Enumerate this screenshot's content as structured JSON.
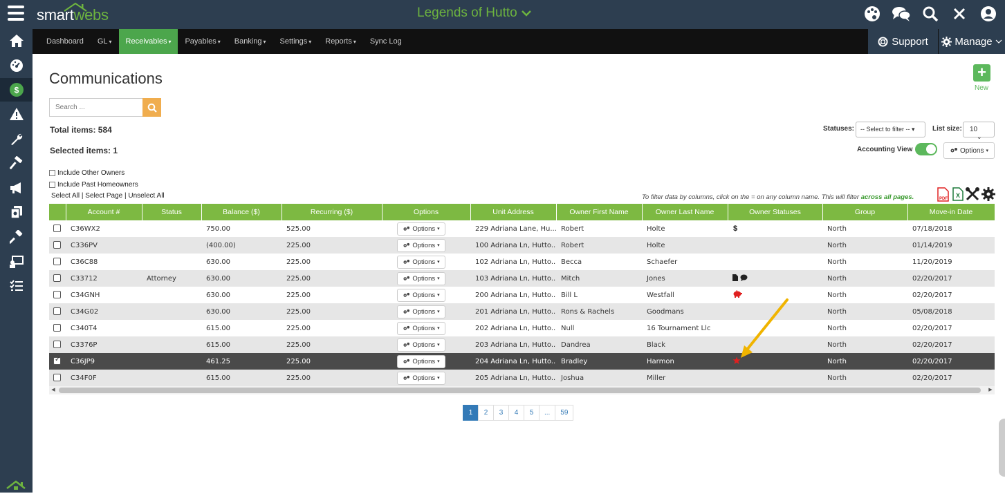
{
  "app": {
    "brand_part1": "smart",
    "brand_part2": "webs",
    "community": "Legends of Hutto"
  },
  "nav": {
    "items": [
      "Dashboard",
      "GL",
      "Receivables",
      "Payables",
      "Banking",
      "Settings",
      "Reports",
      "Sync Log"
    ],
    "dropdown_suffix": "▾",
    "support": "Support",
    "manage": "Manage"
  },
  "page": {
    "title": "Communications",
    "new_label": "New",
    "search_placeholder": "Search ...",
    "total_items": "Total items: 584",
    "selected_items": "Selected items: 1",
    "include_other_owners": "Include Other Owners",
    "include_past_homeowners": "Include Past Homeowners",
    "select_all": "Select All",
    "select_page": "Select Page",
    "unselect_all": "Unselect All",
    "statuses_label": "Statuses:",
    "statuses_select": "-- Select to filter --",
    "list_size_label": "List size:",
    "list_size_value": "10",
    "accounting_view": "Accounting View",
    "options": "Options",
    "filter_note_prefix": "To filter data by columns, click on the = on any column name. This will filter ",
    "filter_note_bold": "across all pages."
  },
  "table": {
    "headers": [
      "",
      "Account #",
      "Status",
      "Balance ($)",
      "Recurring ($)",
      "Options",
      "Unit Address",
      "Owner First Name",
      "Owner Last Name",
      "Owner Statuses",
      "Group",
      "Move-in Date"
    ],
    "rows": [
      {
        "checked": false,
        "account": "C36WX2",
        "status": "",
        "balance": "750.00",
        "recurring": "525.00",
        "options": "Options",
        "address": "229 Adriana Lane, Hu...",
        "first": "Robert",
        "last": "Holte",
        "owner_status": "dollar-icon",
        "group": "North",
        "movein": "07/18/2018"
      },
      {
        "checked": false,
        "account": "C336PV",
        "status": "",
        "balance": "(400.00)",
        "recurring": "225.00",
        "options": "Options",
        "address": "100 Adriana Ln, Hutto...",
        "first": "Robert",
        "last": "Holte",
        "owner_status": "",
        "group": "North",
        "movein": "01/14/2019"
      },
      {
        "checked": false,
        "account": "C36C88",
        "status": "",
        "balance": "630.00",
        "recurring": "225.00",
        "options": "Options",
        "address": "102 Adriana Ln, Hutto...",
        "first": "Becca",
        "last": "Schaefer",
        "owner_status": "",
        "group": "North",
        "movein": "11/20/2019"
      },
      {
        "checked": false,
        "account": "C33712",
        "status": "Attorney",
        "balance": "630.00",
        "recurring": "225.00",
        "options": "Options",
        "address": "103 Adriana Ln, Hutto...",
        "first": "Mitch",
        "last": "Jones",
        "owner_status": "doc-chat-icons",
        "group": "North",
        "movein": "02/20/2017"
      },
      {
        "checked": false,
        "account": "C34GNH",
        "status": "",
        "balance": "630.00",
        "recurring": "225.00",
        "options": "Options",
        "address": "200 Adriana Ln, Hutto...",
        "first": "Bill L",
        "last": "Westfall",
        "owner_status": "piggy-bank-icon",
        "group": "North",
        "movein": "02/20/2017"
      },
      {
        "checked": false,
        "account": "C34G02",
        "status": "",
        "balance": "630.00",
        "recurring": "225.00",
        "options": "Options",
        "address": "201 Adriana Ln, Hutto...",
        "first": "Rons & Rachels",
        "last": "Goodmans",
        "owner_status": "",
        "group": "North",
        "movein": "05/08/2018"
      },
      {
        "checked": false,
        "account": "C340T4",
        "status": "",
        "balance": "615.00",
        "recurring": "225.00",
        "options": "Options",
        "address": "202 Adriana Ln, Hutto...",
        "first": "Null",
        "last": "16 Tournament Llc",
        "owner_status": "",
        "group": "North",
        "movein": "02/20/2017"
      },
      {
        "checked": false,
        "account": "C3376P",
        "status": "",
        "balance": "615.00",
        "recurring": "225.00",
        "options": "Options",
        "address": "203 Adriana Ln, Hutto...",
        "first": "Dandrea",
        "last": "Black",
        "owner_status": "",
        "group": "North",
        "movein": "02/20/2017"
      },
      {
        "checked": true,
        "account": "C36JP9",
        "status": "",
        "balance": "461.25",
        "recurring": "225.00",
        "options": "Options",
        "address": "204 Adriana Ln, Hutto...",
        "first": "Bradley",
        "last": "Harmon",
        "owner_status": "star-icon",
        "group": "North",
        "movein": "02/20/2017"
      },
      {
        "checked": false,
        "account": "C34F0F",
        "status": "",
        "balance": "615.00",
        "recurring": "225.00",
        "options": "Options",
        "address": "205 Adriana Ln, Hutto...",
        "first": "Joshua",
        "last": "Miller",
        "owner_status": "",
        "group": "North",
        "movein": "02/20/2017"
      }
    ]
  },
  "pagination": {
    "pages": [
      "1",
      "2",
      "3",
      "4",
      "5",
      "...",
      "59"
    ],
    "active": "1"
  },
  "colors": {
    "header_green": "#7db942",
    "nav_active": "#4ca64c",
    "sidebar": "#2d3e50",
    "accent_orange": "#f0ad4e",
    "pager_blue": "#337ab7",
    "annotation_arrow": "#f0b400"
  }
}
